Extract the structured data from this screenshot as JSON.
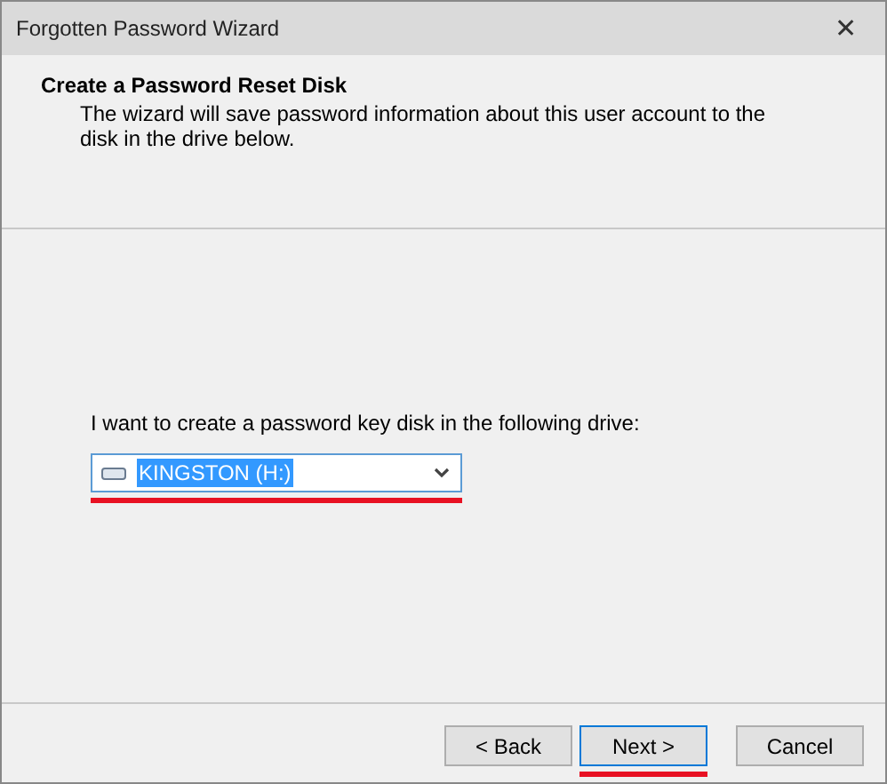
{
  "window": {
    "title": "Forgotten Password Wizard",
    "close": "✕"
  },
  "header": {
    "title": "Create a Password Reset Disk",
    "description": "The wizard will save password information about this user account to the disk in the drive below."
  },
  "drive": {
    "label": "I want to create a password key disk in the following drive:",
    "value": "KINGSTON (H:)",
    "highlighted": true
  },
  "buttons": [
    {
      "label": "< Back",
      "focused": false,
      "highlighted": false
    },
    {
      "label": "Next >",
      "focused": true,
      "highlighted": true
    },
    {
      "label": "Cancel",
      "focused": false,
      "highlighted": false
    }
  ]
}
